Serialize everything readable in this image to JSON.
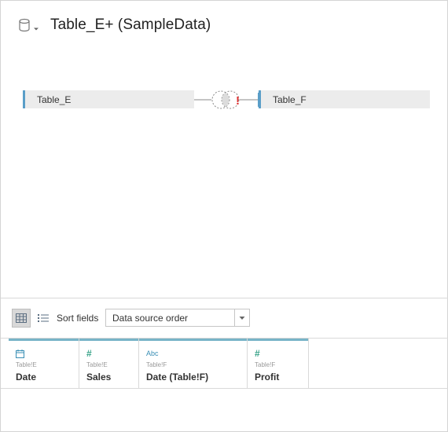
{
  "header": {
    "title": "Table_E+ (SampleData)",
    "icon": "database-icon"
  },
  "join": {
    "left_table": "Table_E",
    "right_table": "Table_F",
    "join_icon": "inner-join-icon",
    "warning": "!",
    "accent_color": "#5a9ec8",
    "warning_color": "#e03131"
  },
  "toolbar": {
    "sort_label": "Sort fields",
    "sort_value": "Data source order"
  },
  "fields": [
    {
      "type": "date",
      "type_icon": "calendar-icon",
      "source": "Table!E",
      "name": "Date"
    },
    {
      "type": "number",
      "type_icon": "#",
      "source": "Table!E",
      "name": "Sales"
    },
    {
      "type": "string",
      "type_icon": "Abc",
      "source": "Table!F",
      "name": "Date (Table!F)"
    },
    {
      "type": "number",
      "type_icon": "#",
      "source": "Table!F",
      "name": "Profit"
    }
  ]
}
